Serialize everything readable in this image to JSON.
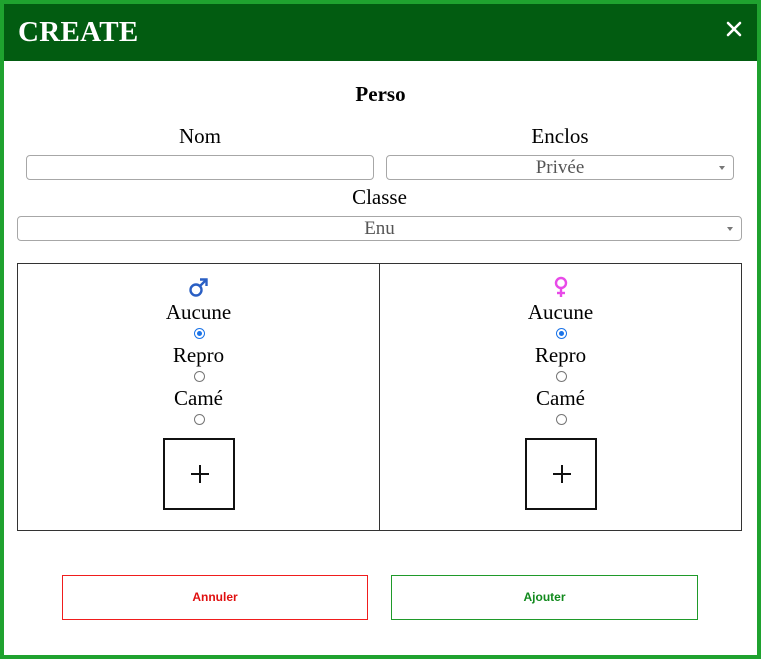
{
  "header": {
    "title": "CREATE",
    "close_icon": "close-icon"
  },
  "form": {
    "section_title": "Perso",
    "nom": {
      "label": "Nom",
      "value": "",
      "placeholder": ""
    },
    "enclos": {
      "label": "Enclos",
      "selected": "Privée"
    },
    "classe": {
      "label": "Classe",
      "selected": "Enu"
    }
  },
  "panels": {
    "male": {
      "icon": "male-symbol-icon",
      "icon_color": "#2a5fc4",
      "options": [
        "Aucune",
        "Repro",
        "Camé"
      ],
      "selected_index": 0
    },
    "female": {
      "icon": "female-symbol-icon",
      "icon_color": "#e84ae8",
      "options": [
        "Aucune",
        "Repro",
        "Camé"
      ],
      "selected_index": 0
    }
  },
  "actions": {
    "cancel_label": "Annuler",
    "add_label": "Ajouter"
  },
  "colors": {
    "header_bg": "#025c11",
    "frame": "#1fa22f",
    "cancel": "#e01010",
    "add": "#118a1d"
  }
}
